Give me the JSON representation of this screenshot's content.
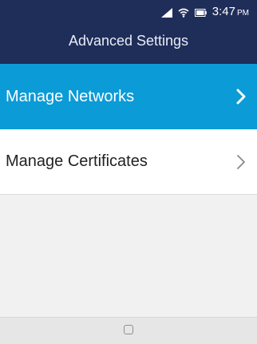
{
  "status_bar": {
    "time": "3:47",
    "ampm": "PM",
    "icons": [
      "signal-icon",
      "wifi-icon",
      "battery-icon"
    ]
  },
  "header": {
    "title": "Advanced Settings"
  },
  "list": {
    "items": [
      {
        "label": "Manage Networks",
        "selected": true
      },
      {
        "label": "Manage Certificates",
        "selected": false
      }
    ]
  },
  "nav": {
    "icons": [
      "home-icon"
    ]
  },
  "colors": {
    "header_bg": "#1f2d59",
    "selected_bg": "#0b9bd7",
    "background": "#f1f1f1"
  }
}
